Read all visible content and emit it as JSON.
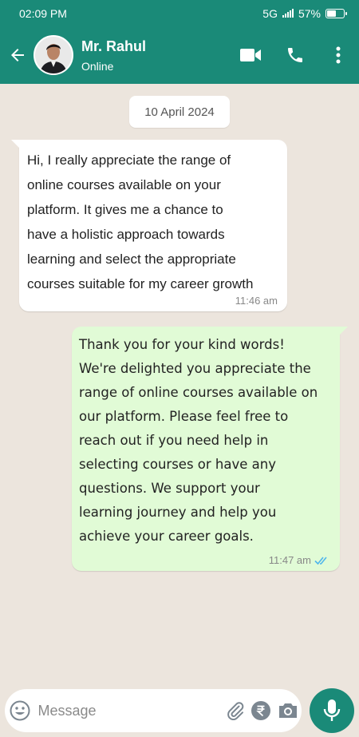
{
  "status_bar": {
    "time": "02:09 PM",
    "network": "5G",
    "battery": "57%",
    "battery_level": 0.57
  },
  "header": {
    "contact_name": "Mr. Rahul",
    "contact_status": "Online",
    "back_icon": "arrow-left-icon",
    "video_icon": "video-call-icon",
    "call_icon": "phone-icon",
    "menu_icon": "more-vertical-icon"
  },
  "chat": {
    "date": "10 April 2024",
    "messages": [
      {
        "direction": "incoming",
        "text": " Hi, I really appreciate the range of\nonline courses available on your\nplatform. It gives me a chance to\nhave a holistic approach towards\nlearning and select the appropriate\ncourses suitable for my career growth",
        "time": "11:46 am"
      },
      {
        "direction": "outgoing",
        "text": " Thank you for your kind words!\nWe're delighted you appreciate the\nrange of online courses available on\nour platform. Please feel free to\nreach out if you need help in\nselecting courses or have any\nquestions. We support your\nlearning journey and help you\nachieve your career goals.",
        "time": "11:47 am",
        "read_receipt": "double-check-icon"
      }
    ]
  },
  "composer": {
    "placeholder": "Message",
    "emoji_icon": "emoji-icon",
    "attach_icon": "paperclip-icon",
    "payment_icon": "rupee-icon",
    "camera_icon": "camera-icon",
    "mic_icon": "microphone-icon"
  },
  "colors": {
    "header": "#1a8a78",
    "outgoing_bubble": "#e1fbd6",
    "read_tick": "#4fb6ec"
  }
}
